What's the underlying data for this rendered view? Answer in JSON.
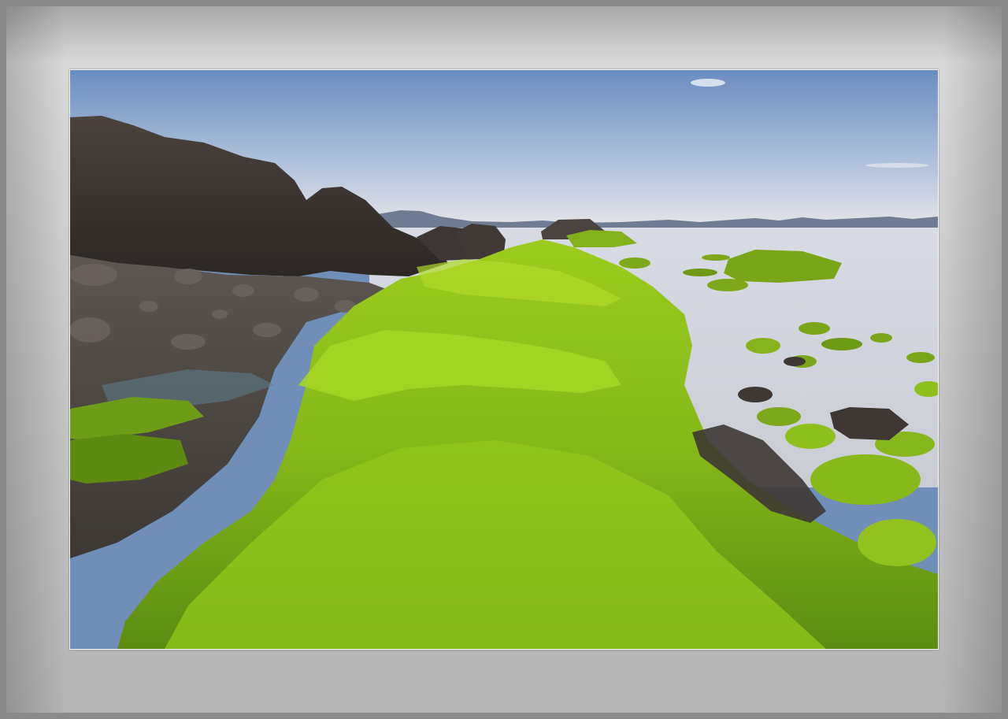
{
  "scene": {
    "subject": "",
    "colors": {
      "mat_outer": "#8a8a8a",
      "mat_light": "#d9d9d9",
      "sky_top": "#6f8fc2",
      "sky_horizon": "#e6e7ec",
      "water": "#dcdde3",
      "algae_bright": "#a6d21f",
      "algae_dark": "#4f7a10",
      "rock_dark": "#3a3431",
      "mountain_far": "#6f7c91"
    }
  }
}
